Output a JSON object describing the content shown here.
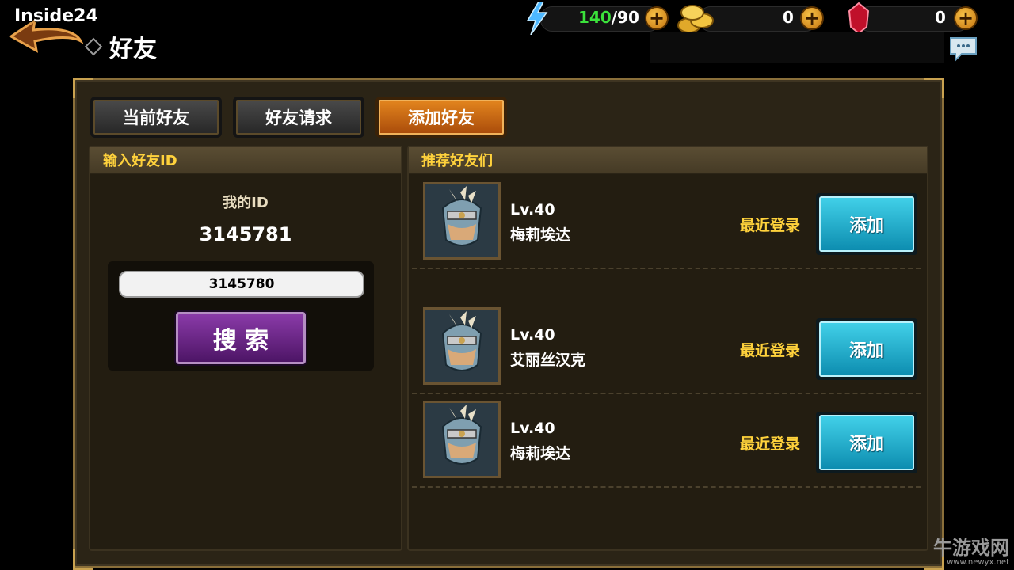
{
  "watermark_top": "Inside24",
  "header": {
    "title": "好友"
  },
  "resources": {
    "energy": {
      "current": "140",
      "separator_max": "/90",
      "icon": "lightning-icon"
    },
    "gold": {
      "value": "0",
      "icon": "gold-coins-icon"
    },
    "gems": {
      "value": "0",
      "icon": "red-gem-icon"
    }
  },
  "tabs": [
    {
      "label": "当前好友",
      "active": false
    },
    {
      "label": "好友请求",
      "active": false
    },
    {
      "label": "添加好友",
      "active": true
    }
  ],
  "left_panel": {
    "header": "输入好友ID",
    "my_id_label": "我的ID",
    "my_id_value": "3145781",
    "input_value": "3145780",
    "search_label": "搜 索"
  },
  "right_panel": {
    "header": "推荐好友们",
    "friends": [
      {
        "level": "Lv.40",
        "name": "梅莉埃达",
        "status": "最近登录",
        "button": "添加"
      },
      {
        "level": "Lv.40",
        "name": "艾丽丝汉克",
        "status": "最近登录",
        "button": "添加"
      },
      {
        "level": "Lv.40",
        "name": "梅莉埃达",
        "status": "最近登录",
        "button": "添加"
      }
    ]
  },
  "watermark_br": {
    "main": "牛游戏网",
    "url": "www.newyx.net"
  },
  "colors": {
    "accent_gold": "#ffd23c",
    "energy_green": "#3be23b",
    "tab_active": "#e4861e",
    "add_button": "#2fbedb",
    "search_button": "#7a2e96"
  }
}
